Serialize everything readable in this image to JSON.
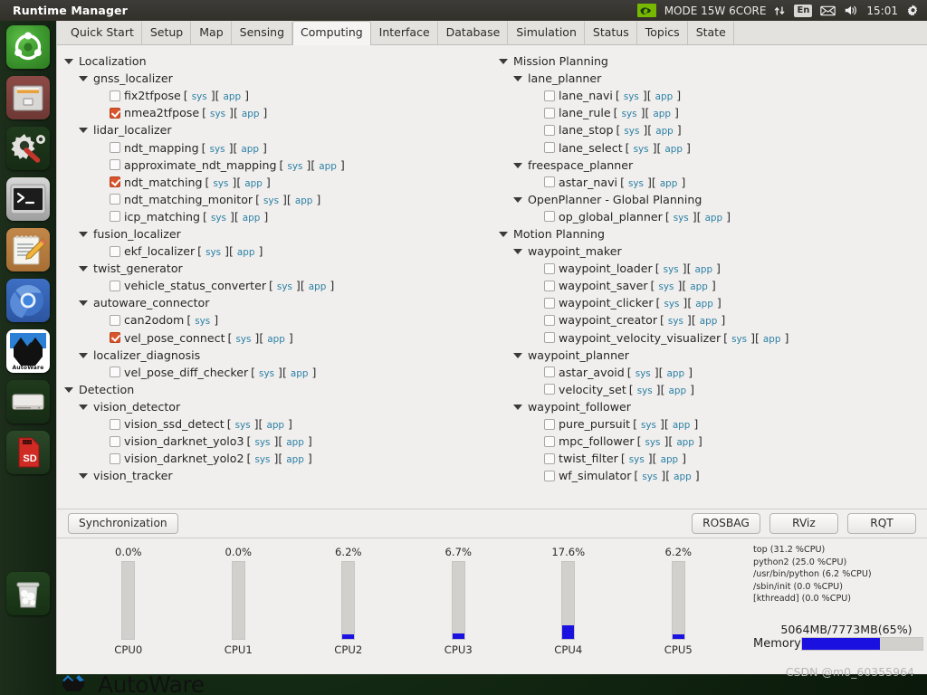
{
  "window": {
    "title": "Runtime Manager"
  },
  "tray": {
    "nvidia_icon": "nvidia-logo-icon",
    "power_mode": "MODE 15W 6CORE",
    "network_icon": "network-updown-icon",
    "keyboard_layout": "En",
    "mail_icon": "mail-icon",
    "volume_icon": "volume-icon",
    "clock": "15:01",
    "settings_icon": "gear-icon"
  },
  "launcher": {
    "items": [
      {
        "name": "ubuntu-dash-icon",
        "label": ""
      },
      {
        "name": "file-manager-icon",
        "label": ""
      },
      {
        "name": "system-settings-icon",
        "label": ""
      },
      {
        "name": "terminal-icon",
        "label": ""
      },
      {
        "name": "text-editor-icon",
        "label": ""
      },
      {
        "name": "chromium-icon",
        "label": ""
      },
      {
        "name": "autoware-icon",
        "label": "AutoWare"
      },
      {
        "name": "disk-drive-icon",
        "label": ""
      },
      {
        "name": "sd-card-icon",
        "label": "SD"
      },
      {
        "name": "trash-icon",
        "label": ""
      }
    ]
  },
  "tabs": [
    {
      "label": "Quick Start",
      "active": false
    },
    {
      "label": "Setup",
      "active": false
    },
    {
      "label": "Map",
      "active": false
    },
    {
      "label": "Sensing",
      "active": false
    },
    {
      "label": "Computing",
      "active": true
    },
    {
      "label": "Interface",
      "active": false
    },
    {
      "label": "Database",
      "active": false
    },
    {
      "label": "Simulation",
      "active": false
    },
    {
      "label": "Status",
      "active": false
    },
    {
      "label": "Topics",
      "active": false
    },
    {
      "label": "State",
      "active": false
    }
  ],
  "buttons": {
    "sys_label": "sys",
    "app_label": "app",
    "bracket_open": "[",
    "bracket_close": "]",
    "synchronization": "Synchronization",
    "rosbag": "ROSBAG",
    "rviz": "RViz",
    "rqt": "RQT"
  },
  "colors": {
    "checkbox_checked": "#d9542b",
    "link": "#2a7fa3",
    "gauge_fill": "#1a10e0",
    "titlebar": "#3e3c38",
    "panel_bg": "#f0efee"
  },
  "left_tree": [
    {
      "depth": 0,
      "type": "node",
      "label": "Localization"
    },
    {
      "depth": 1,
      "type": "node",
      "label": "gnss_localizer"
    },
    {
      "depth": 2,
      "type": "leaf",
      "label": "fix2tfpose",
      "checked": false,
      "sys": true,
      "app": true
    },
    {
      "depth": 2,
      "type": "leaf",
      "label": "nmea2tfpose",
      "checked": true,
      "sys": true,
      "app": true
    },
    {
      "depth": 1,
      "type": "node",
      "label": "lidar_localizer"
    },
    {
      "depth": 2,
      "type": "leaf",
      "label": "ndt_mapping",
      "checked": false,
      "sys": true,
      "app": true
    },
    {
      "depth": 2,
      "type": "leaf",
      "label": "approximate_ndt_mapping",
      "checked": false,
      "sys": true,
      "app": true
    },
    {
      "depth": 2,
      "type": "leaf",
      "label": "ndt_matching",
      "checked": true,
      "sys": true,
      "app": true
    },
    {
      "depth": 2,
      "type": "leaf",
      "label": "ndt_matching_monitor",
      "checked": false,
      "sys": true,
      "app": true
    },
    {
      "depth": 2,
      "type": "leaf",
      "label": "icp_matching",
      "checked": false,
      "sys": true,
      "app": true
    },
    {
      "depth": 1,
      "type": "node",
      "label": "fusion_localizer"
    },
    {
      "depth": 2,
      "type": "leaf",
      "label": "ekf_localizer",
      "checked": false,
      "sys": true,
      "app": true
    },
    {
      "depth": 1,
      "type": "node",
      "label": "twist_generator"
    },
    {
      "depth": 2,
      "type": "leaf",
      "label": "vehicle_status_converter",
      "checked": false,
      "sys": true,
      "app": true
    },
    {
      "depth": 1,
      "type": "node",
      "label": "autoware_connector"
    },
    {
      "depth": 2,
      "type": "leaf",
      "label": "can2odom",
      "checked": false,
      "sys": true,
      "app": false
    },
    {
      "depth": 2,
      "type": "leaf",
      "label": "vel_pose_connect",
      "checked": true,
      "sys": true,
      "app": true
    },
    {
      "depth": 1,
      "type": "node",
      "label": "localizer_diagnosis"
    },
    {
      "depth": 2,
      "type": "leaf",
      "label": "vel_pose_diff_checker",
      "checked": false,
      "sys": true,
      "app": true
    },
    {
      "depth": 0,
      "type": "node",
      "label": "Detection"
    },
    {
      "depth": 1,
      "type": "node",
      "label": "vision_detector"
    },
    {
      "depth": 2,
      "type": "leaf",
      "label": "vision_ssd_detect",
      "checked": false,
      "sys": true,
      "app": true
    },
    {
      "depth": 2,
      "type": "leaf",
      "label": "vision_darknet_yolo3",
      "checked": false,
      "sys": true,
      "app": true
    },
    {
      "depth": 2,
      "type": "leaf",
      "label": "vision_darknet_yolo2",
      "checked": false,
      "sys": true,
      "app": true
    },
    {
      "depth": 1,
      "type": "node",
      "label": "vision_tracker"
    }
  ],
  "right_tree": [
    {
      "depth": 0,
      "type": "node",
      "label": "Mission Planning"
    },
    {
      "depth": 1,
      "type": "node",
      "label": "lane_planner"
    },
    {
      "depth": 2,
      "type": "leaf",
      "label": "lane_navi",
      "checked": false,
      "sys": true,
      "app": true
    },
    {
      "depth": 2,
      "type": "leaf",
      "label": "lane_rule",
      "checked": false,
      "sys": true,
      "app": true
    },
    {
      "depth": 2,
      "type": "leaf",
      "label": "lane_stop",
      "checked": false,
      "sys": true,
      "app": true
    },
    {
      "depth": 2,
      "type": "leaf",
      "label": "lane_select",
      "checked": false,
      "sys": true,
      "app": true
    },
    {
      "depth": 1,
      "type": "node",
      "label": "freespace_planner"
    },
    {
      "depth": 2,
      "type": "leaf",
      "label": "astar_navi",
      "checked": false,
      "sys": true,
      "app": true
    },
    {
      "depth": 1,
      "type": "node",
      "label": "OpenPlanner - Global Planning"
    },
    {
      "depth": 2,
      "type": "leaf",
      "label": "op_global_planner",
      "checked": false,
      "sys": true,
      "app": true
    },
    {
      "depth": 0,
      "type": "node",
      "label": "Motion Planning"
    },
    {
      "depth": 1,
      "type": "node",
      "label": "waypoint_maker"
    },
    {
      "depth": 2,
      "type": "leaf",
      "label": "waypoint_loader",
      "checked": false,
      "sys": true,
      "app": true
    },
    {
      "depth": 2,
      "type": "leaf",
      "label": "waypoint_saver",
      "checked": false,
      "sys": true,
      "app": true
    },
    {
      "depth": 2,
      "type": "leaf",
      "label": "waypoint_clicker",
      "checked": false,
      "sys": true,
      "app": true
    },
    {
      "depth": 2,
      "type": "leaf",
      "label": "waypoint_creator",
      "checked": false,
      "sys": true,
      "app": true
    },
    {
      "depth": 2,
      "type": "leaf",
      "label": "waypoint_velocity_visualizer",
      "checked": false,
      "sys": true,
      "app": true
    },
    {
      "depth": 1,
      "type": "node",
      "label": "waypoint_planner"
    },
    {
      "depth": 2,
      "type": "leaf",
      "label": "astar_avoid",
      "checked": false,
      "sys": true,
      "app": true
    },
    {
      "depth": 2,
      "type": "leaf",
      "label": "velocity_set",
      "checked": false,
      "sys": true,
      "app": true
    },
    {
      "depth": 1,
      "type": "node",
      "label": "waypoint_follower"
    },
    {
      "depth": 2,
      "type": "leaf",
      "label": "pure_pursuit",
      "checked": false,
      "sys": true,
      "app": true
    },
    {
      "depth": 2,
      "type": "leaf",
      "label": "mpc_follower",
      "checked": false,
      "sys": true,
      "app": true
    },
    {
      "depth": 2,
      "type": "leaf",
      "label": "twist_filter",
      "checked": false,
      "sys": true,
      "app": true
    },
    {
      "depth": 2,
      "type": "leaf",
      "label": "wf_simulator",
      "checked": false,
      "sys": true,
      "app": true
    }
  ],
  "cpus": [
    {
      "name": "CPU0",
      "pct_label": "0.0%",
      "pct": 0.0
    },
    {
      "name": "CPU1",
      "pct_label": "0.0%",
      "pct": 0.0
    },
    {
      "name": "CPU2",
      "pct_label": "6.2%",
      "pct": 6.2
    },
    {
      "name": "CPU3",
      "pct_label": "6.7%",
      "pct": 6.7
    },
    {
      "name": "CPU4",
      "pct_label": "17.6%",
      "pct": 17.6
    },
    {
      "name": "CPU5",
      "pct_label": "6.2%",
      "pct": 6.2
    }
  ],
  "processes": [
    "top (31.2 %CPU)",
    "python2 (25.0 %CPU)",
    "/usr/bin/python (6.2 %CPU)",
    "/sbin/init (0.0 %CPU)",
    "[kthreadd] (0.0 %CPU)"
  ],
  "memory": {
    "text": "5064MB/7773MB(65%)",
    "label": "Memory",
    "percent": 65
  },
  "branding": {
    "logo_text": "AutoWare"
  },
  "watermark": "CSDN @m0_60355964"
}
